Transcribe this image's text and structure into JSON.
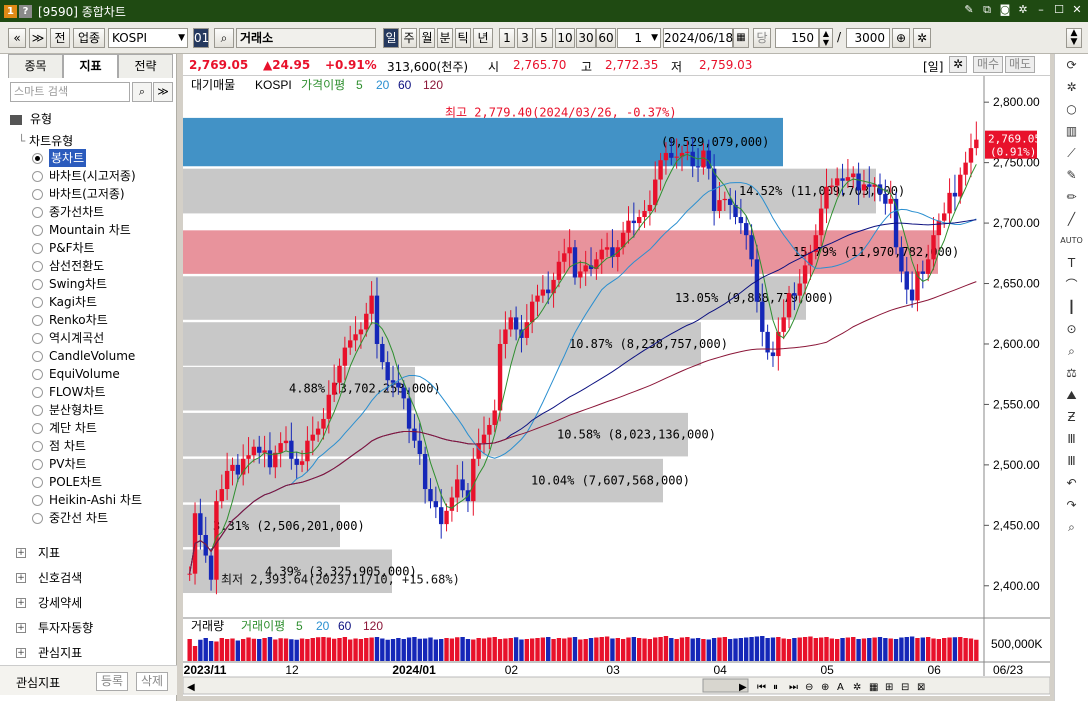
{
  "window": {
    "badge1": "1",
    "badge2": "?",
    "title": "[9590] 종합차트"
  },
  "toolbar": {
    "nav_prev": "«",
    "nav_more": "≫",
    "btn_jeon": "전",
    "btn_upjong": "업종",
    "symbol": "KOSPI",
    "code": "01",
    "market": "거래소",
    "periods": [
      "일",
      "주",
      "월",
      "분",
      "틱",
      "년"
    ],
    "nums": [
      "1",
      "3",
      "5",
      "10",
      "30",
      "60"
    ],
    "count_input": "1",
    "date": "2024/06/18",
    "dang": "당",
    "bars": "150",
    "slash": "/",
    "total": "3000"
  },
  "sidebar": {
    "tabs": [
      "종목",
      "지표",
      "전략"
    ],
    "search_placeholder": "스마트 검색",
    "type_label": "유형",
    "tree_label": "차트유형",
    "items": [
      "봉차트",
      "바차트(시고저종)",
      "바차트(고저종)",
      "종가선차트",
      "Mountain 차트",
      "P&F차트",
      "삼선전환도",
      "Swing차트",
      "Kagi차트",
      "Renko차트",
      "역시계곡선",
      "CandleVolume",
      "EquiVolume",
      "FLOW차트",
      "분산형차트",
      "계단 차트",
      "점 차트",
      "PV차트",
      "POLE차트",
      "Heikin-Ashi 차트",
      "중간선 차트"
    ],
    "groups": [
      "지표",
      "신호검색",
      "강세약세",
      "투자자동향",
      "관심지표"
    ],
    "fav_label": "관심지표",
    "fav_add": "등록",
    "fav_del": "삭제"
  },
  "pricebar": {
    "price": "2,769.05",
    "change": "▲24.95",
    "pct": "+0.91%",
    "volume": "313,600(천주)",
    "open_label": "시",
    "open": "2,765.70",
    "high_label": "고",
    "high": "2,772.35",
    "low_label": "저",
    "low": "2,759.03",
    "period_tag": "[일]",
    "buy": "매수",
    "sell": "매도"
  },
  "colors": {
    "up": "#e8112b",
    "down": "#1527b8",
    "blue_band": "#4292c6",
    "pink_band": "#e8939c",
    "gray_band": "#c8c8c8",
    "ma5": "#2f8f2f",
    "ma20": "#2a8fd0",
    "ma60": "#0c1180",
    "ma120": "#8b1638"
  },
  "chart_data": {
    "type": "candlestick",
    "legend": {
      "name": "대기매물",
      "symbol": "KOSPI",
      "ma_label": "가격이평",
      "ma": [
        "5",
        "20",
        "60",
        "120"
      ]
    },
    "y_ticks": [
      "2,800.00",
      "2,750.00",
      "2,700.00",
      "2,650.00",
      "2,600.00",
      "2,550.00",
      "2,500.00",
      "2,450.00",
      "2,400.00"
    ],
    "ylim": [
      2375,
      2820
    ],
    "x_ticks": [
      {
        "i": 0,
        "label": "2023/11"
      },
      {
        "i": 19,
        "label": "12"
      },
      {
        "i": 39,
        "label": "2024/01"
      },
      {
        "i": 60,
        "label": "02"
      },
      {
        "i": 79,
        "label": "03"
      },
      {
        "i": 99,
        "label": "04"
      },
      {
        "i": 119,
        "label": "05"
      },
      {
        "i": 139,
        "label": "06"
      }
    ],
    "end_date": "06/23",
    "current": {
      "price": "2,769.05",
      "pct": "(0.91%)",
      "value": 2769
    },
    "annotations": {
      "high": "최고 2,779.40(2024/03/26, -0.37%)",
      "low": "최저 2,393.64(2023/11/10, +15.68%)"
    },
    "volume_profile": [
      {
        "lo": 2747,
        "hi": 2787,
        "label": "(9,529,079,000)",
        "kind": "blue"
      },
      {
        "lo": 2708,
        "hi": 2745,
        "label": "14.52% (11,009,703,000)",
        "kind": "gray"
      },
      {
        "lo": 2658,
        "hi": 2694,
        "label": "15.79% (11,970,782,000)",
        "kind": "pink"
      },
      {
        "lo": 2620,
        "hi": 2656,
        "label": "13.05% (9,888,779,000)",
        "kind": "gray"
      },
      {
        "lo": 2582,
        "hi": 2618,
        "label": "10.87% (8,238,757,000)",
        "kind": "gray"
      },
      {
        "lo": 2545,
        "hi": 2581,
        "label": "4.88% (3,702,253,000)",
        "kind": "gray"
      },
      {
        "lo": 2507,
        "hi": 2543,
        "label": "10.58% (8,023,136,000)",
        "kind": "gray"
      },
      {
        "lo": 2469,
        "hi": 2505,
        "label": "10.04% (7,607,568,000)",
        "kind": "gray"
      },
      {
        "lo": 2432,
        "hi": 2467,
        "label": "3.31% (2,506,201,000)",
        "kind": "gray"
      },
      {
        "lo": 2394,
        "hi": 2430,
        "label": "4.39% (3,325,905,000)",
        "kind": "gray"
      }
    ],
    "closes": [
      2410,
      2460,
      2442,
      2425,
      2405,
      2470,
      2480,
      2495,
      2500,
      2492,
      2505,
      2508,
      2515,
      2510,
      2512,
      2498,
      2510,
      2518,
      2520,
      2505,
      2500,
      2503,
      2520,
      2525,
      2530,
      2538,
      2558,
      2568,
      2582,
      2597,
      2603,
      2608,
      2612,
      2625,
      2640,
      2600,
      2585,
      2570,
      2568,
      2564,
      2555,
      2530,
      2520,
      2509,
      2480,
      2470,
      2465,
      2451,
      2462,
      2473,
      2488,
      2479,
      2470,
      2505,
      2518,
      2525,
      2533,
      2545,
      2600,
      2612,
      2622,
      2612,
      2605,
      2618,
      2635,
      2640,
      2645,
      2642,
      2653,
      2668,
      2675,
      2680,
      2655,
      2660,
      2665,
      2662,
      2670,
      2678,
      2680,
      2672,
      2680,
      2692,
      2702,
      2700,
      2705,
      2710,
      2715,
      2736,
      2752,
      2758,
      2754,
      2755,
      2758,
      2759,
      2747,
      2746,
      2760,
      2745,
      2710,
      2719,
      2720,
      2715,
      2705,
      2700,
      2690,
      2670,
      2635,
      2610,
      2593,
      2590,
      2610,
      2622,
      2642,
      2640,
      2650,
      2665,
      2676,
      2690,
      2712,
      2730,
      2731,
      2737,
      2735,
      2738,
      2741,
      2727,
      2732,
      2730,
      2732,
      2724,
      2716,
      2720,
      2680,
      2660,
      2645,
      2636,
      2660,
      2658,
      2670,
      2690,
      2702,
      2708,
      2725,
      2722,
      2740,
      2750,
      2762,
      2769
    ],
    "volumes": [
      88,
      60,
      85,
      92,
      80,
      78,
      92,
      88,
      90,
      82,
      88,
      94,
      89,
      88,
      92,
      96,
      86,
      91,
      90,
      87,
      85,
      90,
      88,
      92,
      95,
      96,
      94,
      89,
      92,
      96,
      86,
      90,
      88,
      92,
      94,
      96,
      90,
      85,
      88,
      92,
      88,
      94,
      96,
      89,
      90,
      94,
      86,
      88,
      92,
      90,
      95,
      96,
      88,
      86,
      92,
      90,
      94,
      96,
      88,
      90,
      92,
      95,
      86,
      88,
      90,
      92,
      94,
      96,
      88,
      92,
      90,
      94,
      96,
      86,
      88,
      92,
      94,
      96,
      98,
      90,
      92,
      88,
      94,
      96,
      92,
      90,
      88,
      94,
      96,
      100,
      92,
      88,
      94,
      96,
      90,
      92,
      88,
      86,
      92,
      94,
      96,
      88,
      90,
      92,
      94,
      96,
      98,
      100,
      92,
      94,
      96,
      90,
      88,
      92,
      94,
      96,
      98,
      92,
      94,
      96,
      90,
      88,
      92,
      94,
      96,
      88,
      90,
      92,
      94,
      96,
      92,
      90,
      88,
      94,
      96,
      98,
      92,
      94,
      96,
      90,
      88,
      92,
      94,
      95,
      96,
      92,
      90,
      85
    ],
    "vol_legend": {
      "name": "거래량",
      "ma_label": "거래이평",
      "ma": [
        "5",
        "20",
        "60",
        "120"
      ]
    },
    "vol_tick": "500,000K"
  }
}
